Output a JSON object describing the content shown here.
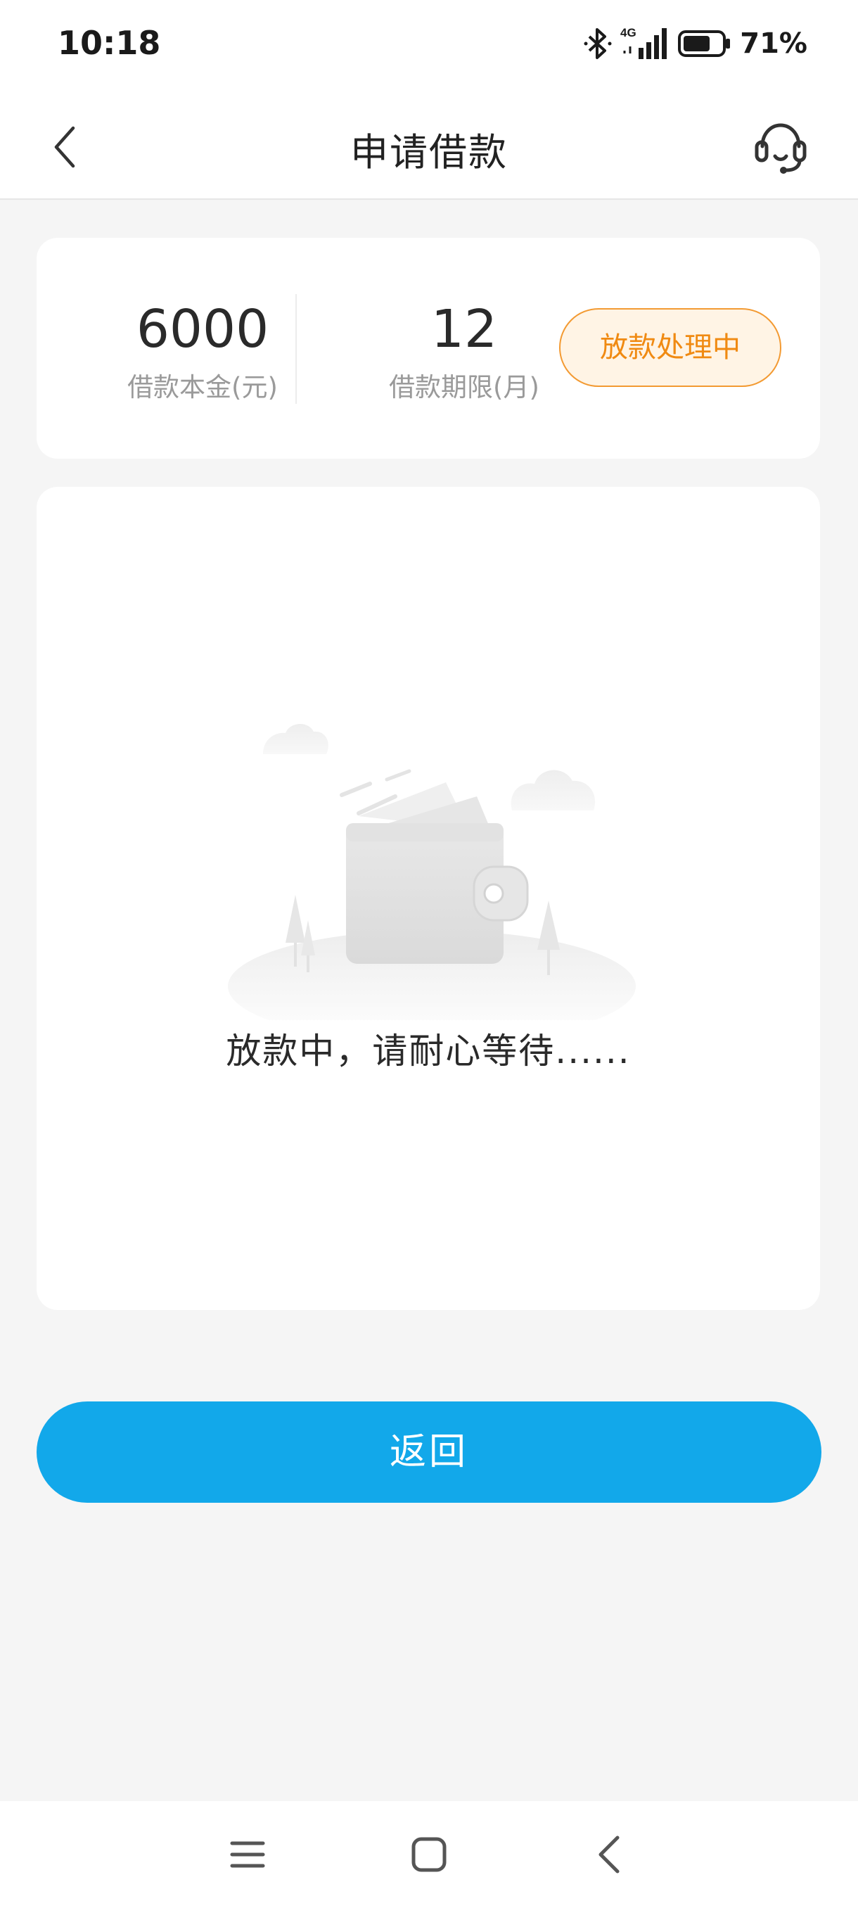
{
  "status_bar": {
    "time": "10:18",
    "network": "4G",
    "battery_percent": "71%",
    "battery_level": 0.71,
    "icons": [
      "bluetooth-icon",
      "signal-4g-icon",
      "battery-icon"
    ]
  },
  "nav": {
    "title": "申请借款",
    "back_icon": "chevron-left-icon",
    "service_icon": "headset-icon"
  },
  "loan_summary": {
    "principal_value": "6000",
    "principal_label": "借款本金(元)",
    "term_value": "12",
    "term_label": "借款期限(月)",
    "status_label": "放款处理中"
  },
  "progress": {
    "illustration": "wallet-icon",
    "message": "放款中，请耐心等待......"
  },
  "actions": {
    "return_label": "返回"
  },
  "system_nav": {
    "icons": [
      "menu-icon",
      "home-icon",
      "back-icon"
    ]
  },
  "colors": {
    "accent_blue": "#12a8ea",
    "status_orange": "#f08a12",
    "status_orange_bg": "#fff4e5",
    "page_bg": "#f5f5f5",
    "card_bg": "#ffffff",
    "text_primary": "#2a2a2a",
    "text_secondary": "#9a9a9a"
  }
}
